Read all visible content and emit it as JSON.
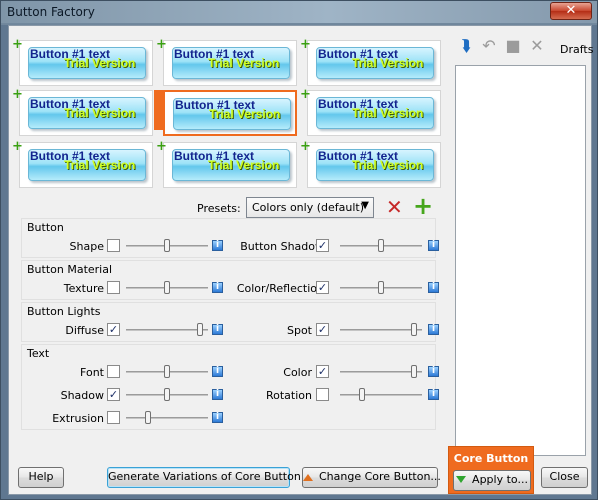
{
  "window": {
    "title": "Button Factory",
    "close_label": "✕"
  },
  "previews": [
    {
      "button_text": "Button #1 text",
      "watermark": "Trial Version"
    },
    {
      "button_text": "Button #1 text",
      "watermark": "Trial Version"
    },
    {
      "button_text": "Button #1 text",
      "watermark": "Trial Version"
    },
    {
      "button_text": "Button #1 text",
      "watermark": "Trial Version"
    },
    {
      "button_text": "Button #1 text",
      "watermark": "Trial Version"
    },
    {
      "button_text": "Button #1 text",
      "watermark": "Trial Version"
    },
    {
      "button_text": "Button #1 text",
      "watermark": "Trial Version"
    },
    {
      "button_text": "Button #1 text",
      "watermark": "Trial Version"
    },
    {
      "button_text": "Button #1 text",
      "watermark": "Trial Version"
    }
  ],
  "drafts": {
    "label": "Drafts"
  },
  "presets": {
    "label": "Presets:",
    "value": "Colors only (default)"
  },
  "groups": {
    "button": {
      "title": "Button",
      "shape": "Shape",
      "shadow": "Button Shadow"
    },
    "material": {
      "title": "Button Material",
      "texture": "Texture",
      "reflection": "Color/Reflection"
    },
    "lights": {
      "title": "Button Lights",
      "diffuse": "Diffuse",
      "spot": "Spot"
    },
    "text": {
      "title": "Text",
      "font": "Font",
      "color": "Color",
      "shadow": "Shadow",
      "rotation": "Rotation",
      "extrusion": "Extrusion"
    }
  },
  "checks": {
    "shape": false,
    "button_shadow": true,
    "texture": false,
    "reflection": true,
    "diffuse": true,
    "spot": true,
    "font": false,
    "color": true,
    "shadow": true,
    "rotation": false,
    "extrusion": false
  },
  "slider_levels": {
    "shape": 0.5,
    "button_shadow": 0.5,
    "texture": 0.5,
    "reflection": 0.5,
    "diffuse": 0.93,
    "spot": 0.93,
    "font": 0.5,
    "color": 0.93,
    "shadow": 0.5,
    "rotation": 0.25,
    "extrusion": 0.25
  },
  "buttons": {
    "help": "Help",
    "generate": "Generate Variations of Core Button",
    "change_core": "Change Core Button...",
    "core_title": "Core Button",
    "apply": "Apply to...",
    "close": "Close"
  },
  "colors": {
    "accent": "#ef6b1f",
    "check": "#1c2f67"
  }
}
